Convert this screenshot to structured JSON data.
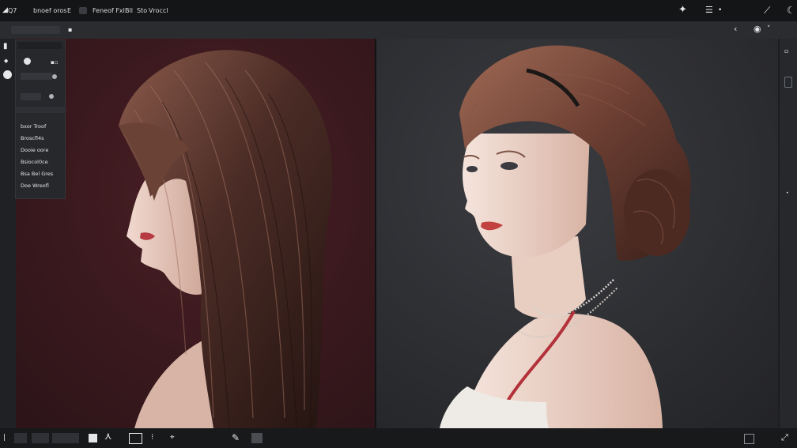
{
  "titlebar": {
    "app_name": "Q7",
    "menus": [
      "bnoef oros",
      "E",
      "Feneof Fxl",
      "Bll",
      "Sto",
      "Vroccl"
    ]
  },
  "panel": {
    "rows": [
      "bxor Troof",
      "Broscfl4s",
      "Dooie oore",
      "Bsiocol0ce",
      "Bsa Bel Gres",
      "Doe Wreofl"
    ]
  },
  "icons": {
    "titlebar": [
      "brush-icon",
      "list-icon",
      "wand-icon",
      "moon-icon"
    ],
    "toolbar": [
      "back-icon",
      "eye-icon"
    ],
    "statusbar": [
      "crop-icon",
      "lasso-icon",
      "frame-icon",
      "text-icon",
      "pin-icon",
      "pen-icon",
      "layers-icon",
      "expand-icon"
    ]
  },
  "colors": {
    "canvas_left_bg": "#3a1a1f",
    "canvas_right_bg": "#2b2c30",
    "chrome_dark": "#141517",
    "chrome_mid": "#2a2c30"
  }
}
